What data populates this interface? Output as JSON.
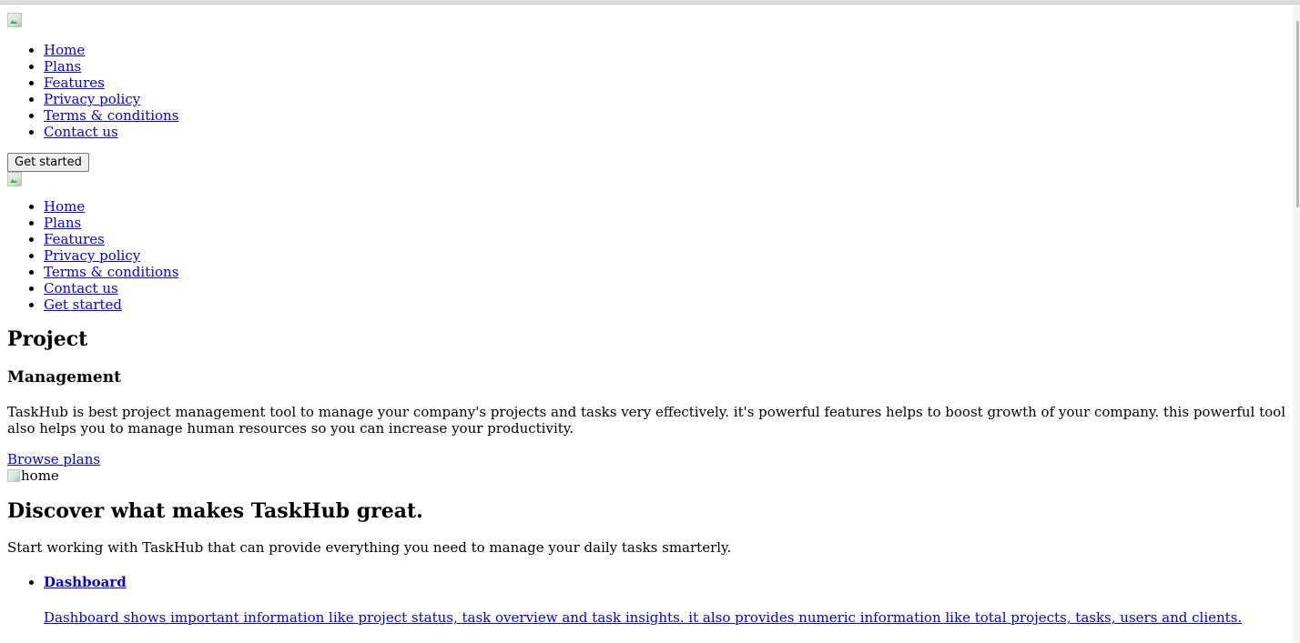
{
  "top_nav": {
    "items": [
      "Home",
      "Plans",
      "Features",
      "Privacy policy",
      "Terms & conditions",
      "Contact us"
    ],
    "cta_button": "Get started"
  },
  "mobile_nav": {
    "items": [
      "Home",
      "Plans",
      "Features",
      "Privacy policy",
      "Terms & conditions",
      "Contact us",
      "Get started"
    ]
  },
  "hero": {
    "title": "Project",
    "subtitle": "Management",
    "description": "TaskHub is best project management tool to manage your company's projects and tasks very effectively. it's powerful features helps to boost growth of your company. this powerful tool also helps you to manage human resources so you can increase your productivity.",
    "browse_link": "Browse plans",
    "image_alt": "home"
  },
  "discover": {
    "title": "Discover what makes TaskHub great.",
    "intro": "Start working with TaskHub that can provide everything you need to manage your daily tasks smarterly.",
    "features": [
      {
        "title": "Dashboard",
        "description": "Dashboard shows important information like project status, task overview and task insights. it also provides numeric information like total projects, tasks, users and clients."
      }
    ]
  }
}
